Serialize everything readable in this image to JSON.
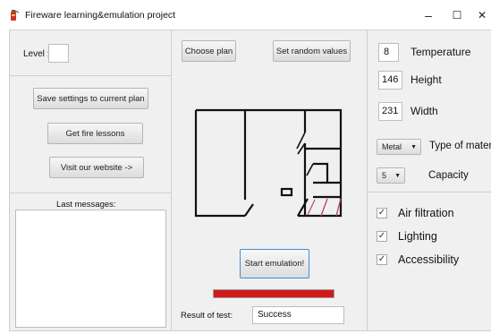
{
  "window": {
    "title": "Fireware learning&emulation project",
    "minimize_glyph": "–",
    "maximize_glyph": "☐",
    "close_glyph": "✕"
  },
  "left": {
    "level_label": "Level :",
    "level_value": "",
    "save_button": "Save settings to current plan",
    "lessons_button": "Get fire lessons",
    "website_button": "Visit our website ->",
    "messages_label": "Last messages:",
    "messages_value": ""
  },
  "center": {
    "choose_plan_button": "Choose plan",
    "random_values_button": "Set random  values",
    "start_button": "Start emulation!",
    "progress": 1.0,
    "result_label": "Result of test:",
    "result_value": "Success"
  },
  "right": {
    "temperature_value": "8",
    "temperature_label": "Temperature",
    "height_value": "146",
    "height_label": "Height",
    "width_value": "231",
    "width_label": "Width",
    "material_value": "Metal",
    "material_label": "Type of materia",
    "capacity_value": "5",
    "capacity_label": "Capacity",
    "checks": [
      {
        "label": "Air filtration",
        "checked": true
      },
      {
        "label": "Lighting",
        "checked": true
      },
      {
        "label": "Accessibility",
        "checked": true
      }
    ]
  },
  "colors": {
    "progress_fill": "#d11a1a",
    "focus_border": "#3c8fd6"
  },
  "icons": {
    "app": "fire-extinguisher-icon",
    "dropdown": "chevron-down-icon"
  }
}
